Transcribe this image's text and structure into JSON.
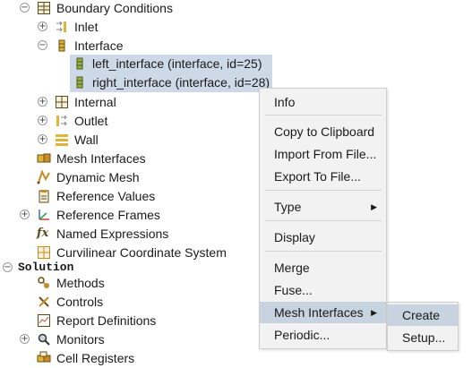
{
  "tree": {
    "boundary_conditions": "Boundary Conditions",
    "inlet": "Inlet",
    "interface": "Interface",
    "left_interface": "left_interface (interface, id=25)",
    "right_interface": "right_interface (interface, id=28)",
    "internal": "Internal",
    "outlet": "Outlet",
    "wall": "Wall",
    "mesh_interfaces": "Mesh Interfaces",
    "dynamic_mesh": "Dynamic Mesh",
    "reference_values": "Reference Values",
    "reference_frames": "Reference Frames",
    "named_expressions": "Named Expressions",
    "curvilinear": "Curvilinear Coordinate System",
    "solution": "Solution",
    "methods": "Methods",
    "controls": "Controls",
    "report_definitions": "Report Definitions",
    "monitors": "Monitors",
    "cell_registers": "Cell Registers"
  },
  "menu": {
    "info": "Info",
    "copy": "Copy to Clipboard",
    "import": "Import From File...",
    "export": "Export To File...",
    "type": "Type",
    "display": "Display",
    "merge": "Merge",
    "fuse": "Fuse...",
    "mesh_interfaces": "Mesh Interfaces",
    "periodic": "Periodic..."
  },
  "submenu": {
    "create": "Create",
    "setup": "Setup..."
  },
  "colors": {
    "selection": "#cdd9e6",
    "menu_highlight": "#c8d3e0",
    "menu_bg": "#f2f2f2"
  }
}
